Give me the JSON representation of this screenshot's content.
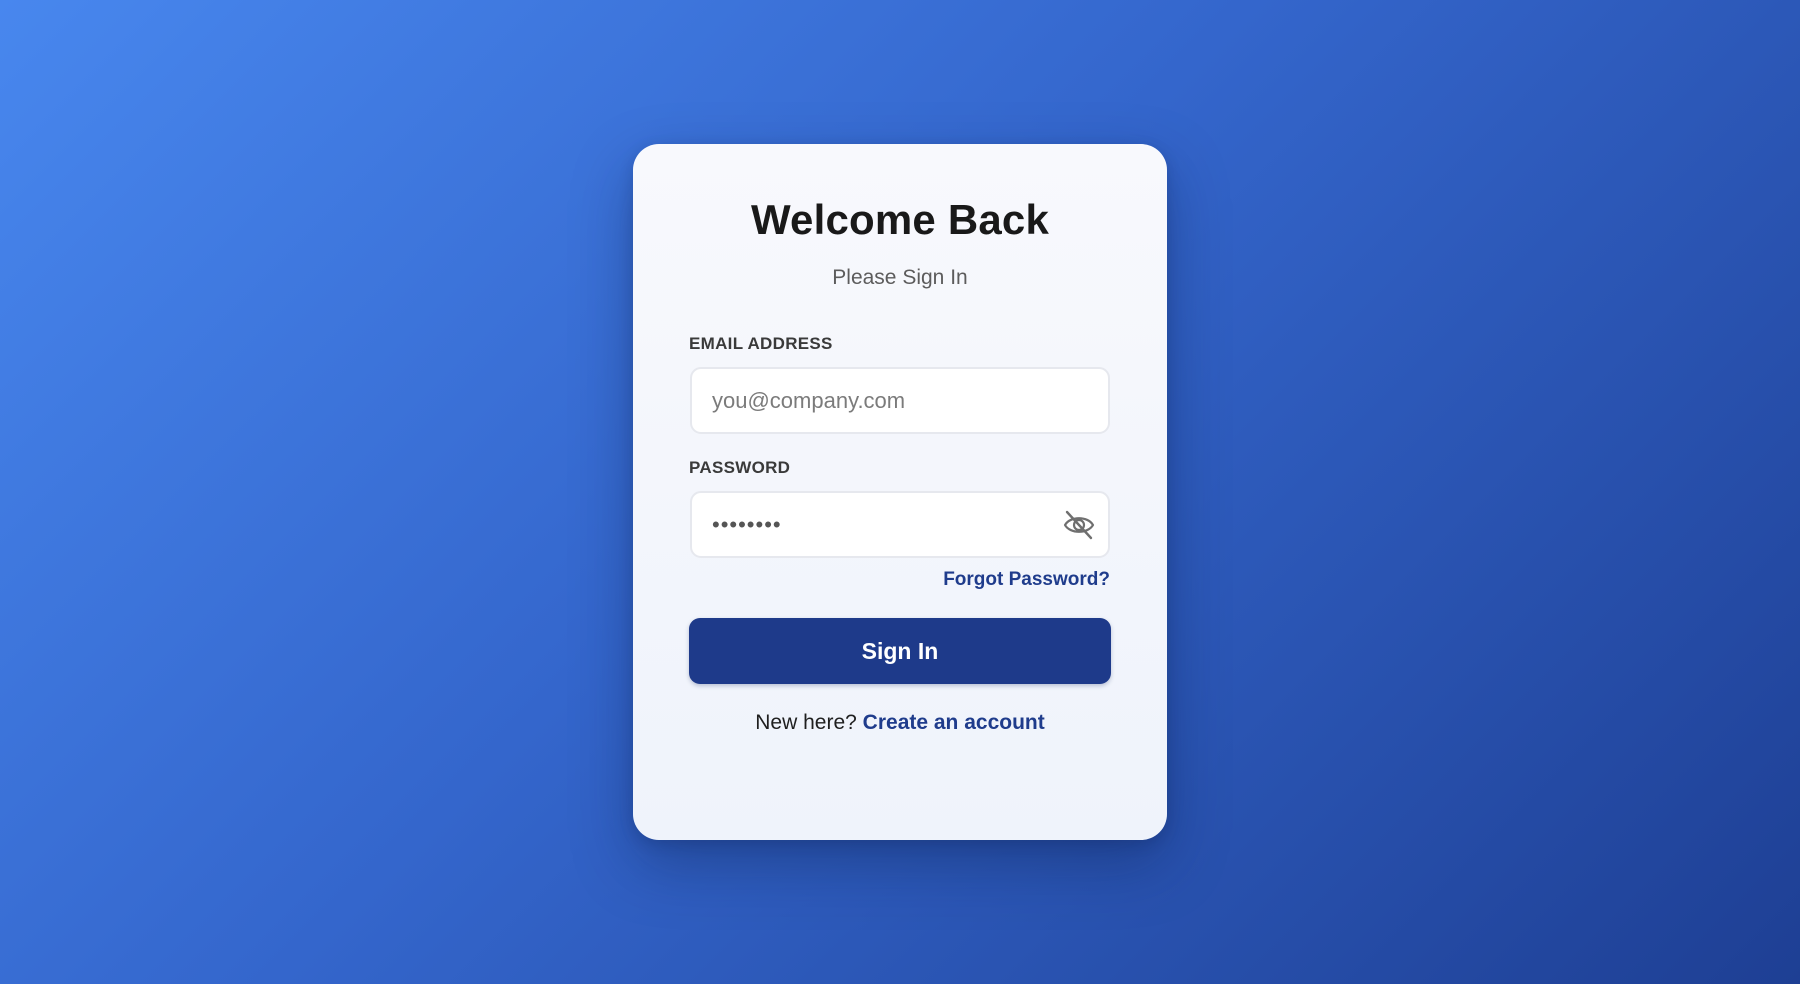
{
  "login": {
    "title": "Welcome Back",
    "subtitle": "Please Sign In",
    "email": {
      "label": "EMAIL ADDRESS",
      "placeholder": "you@company.com",
      "value": ""
    },
    "password": {
      "label": "PASSWORD",
      "value": "••••••••",
      "toggle_icon": "eye-off-icon"
    },
    "forgot_link": "Forgot Password?",
    "submit_label": "Sign In",
    "signup_prompt": "New here?",
    "signup_link": "Create an account"
  },
  "colors": {
    "background_start": "#4887ee",
    "background_end": "#1e3f94",
    "card": "#f5f7fc",
    "primary": "#1e3a8a",
    "link": "#1f3c8c"
  }
}
